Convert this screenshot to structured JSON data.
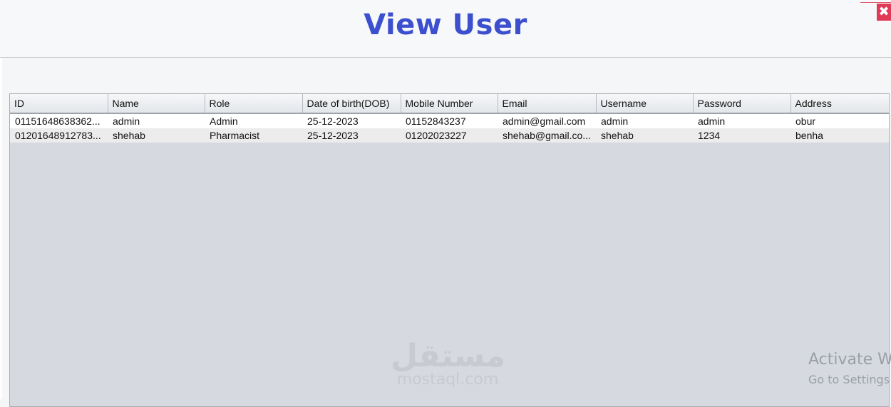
{
  "window": {
    "title": "View User",
    "close_glyph": "✖"
  },
  "table": {
    "columns": [
      "ID",
      "Name",
      "Role",
      "Date of birth(DOB)",
      "Mobile Number",
      "Email",
      "Username",
      "Password",
      "Address"
    ],
    "rows": [
      [
        "01151648638362...",
        "admin",
        "Admin",
        "25-12-2023",
        "01152843237",
        "admin@gmail.com",
        "admin",
        "admin",
        "obur"
      ],
      [
        "01201648912783...",
        "shehab",
        "Pharmacist",
        "25-12-2023",
        "01202023227",
        "shehab@gmail.co...",
        "shehab",
        "1234",
        "benha"
      ]
    ]
  },
  "watermark": {
    "arabic": "مستقل",
    "latin": "mostaql.com"
  },
  "activation_notice": {
    "title": "Activate W",
    "subtitle": "Go to Settings"
  },
  "colors": {
    "title": "#3b4fcf",
    "close_button": "#e03a57",
    "table_background": "#d6d9e0"
  }
}
